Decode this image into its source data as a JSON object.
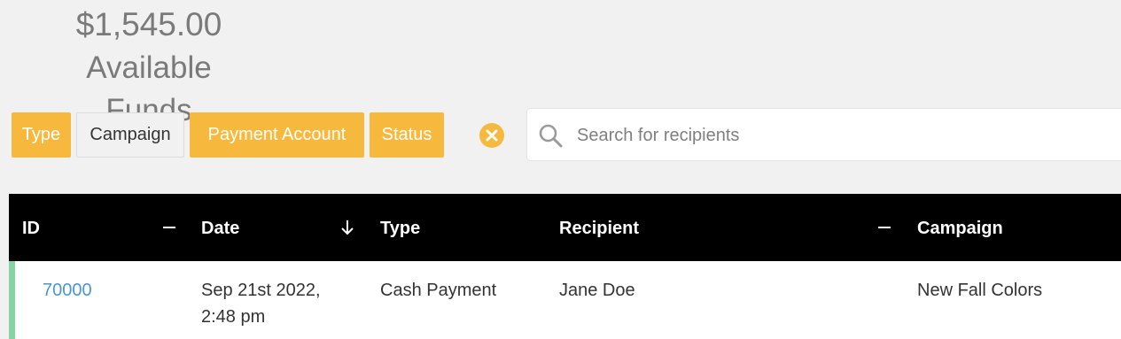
{
  "funds": {
    "amount": "$1,545.00",
    "label": "Available Funds"
  },
  "filters": [
    {
      "label": "Type",
      "active": true
    },
    {
      "label": "Campaign",
      "active": false
    },
    {
      "label": "Payment Account",
      "active": true
    },
    {
      "label": "Status",
      "active": true
    }
  ],
  "clear_icon": "close-circle-icon",
  "search": {
    "placeholder": "Search for recipients",
    "value": "",
    "icon": "search-icon"
  },
  "table": {
    "columns": [
      {
        "label": "ID",
        "control": "minus"
      },
      {
        "label": "Date",
        "control": "sort-descending"
      },
      {
        "label": "Type",
        "control": ""
      },
      {
        "label": "Recipient",
        "control": "minus"
      },
      {
        "label": "Campaign",
        "control": ""
      }
    ],
    "rows": [
      {
        "id": "70000",
        "date_line1": "Sep 21st 2022,",
        "date_line2": "2:48 pm",
        "type": "Cash Payment",
        "recipient": "Jane Doe",
        "campaign": "New Fall Colors",
        "status_color": "#86d4a2"
      }
    ]
  },
  "colors": {
    "accent": "#f7b93d",
    "header_bg": "#000000",
    "link": "#4a97cf",
    "row_marker": "#86d4a2"
  }
}
